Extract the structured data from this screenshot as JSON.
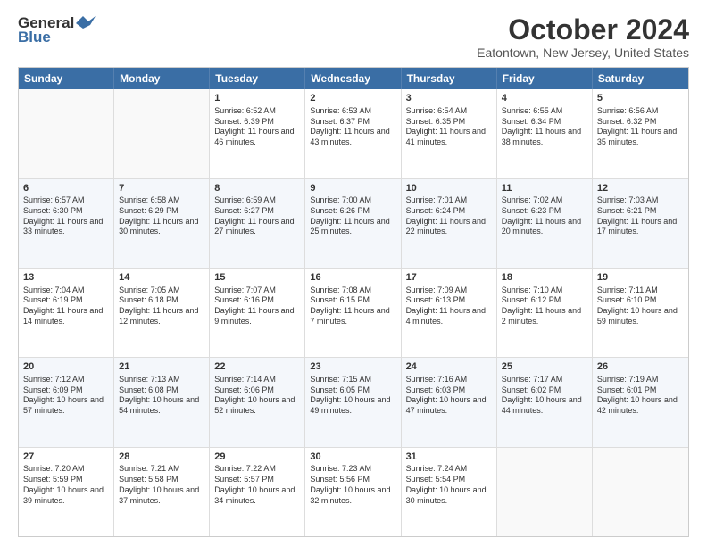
{
  "header": {
    "logo_general": "General",
    "logo_blue": "Blue",
    "month_title": "October 2024",
    "subtitle": "Eatontown, New Jersey, United States"
  },
  "days_of_week": [
    "Sunday",
    "Monday",
    "Tuesday",
    "Wednesday",
    "Thursday",
    "Friday",
    "Saturday"
  ],
  "rows": [
    [
      {
        "day": "",
        "sunrise": "",
        "sunset": "",
        "daylight": "",
        "empty": true
      },
      {
        "day": "",
        "sunrise": "",
        "sunset": "",
        "daylight": "",
        "empty": true
      },
      {
        "day": "1",
        "sunrise": "Sunrise: 6:52 AM",
        "sunset": "Sunset: 6:39 PM",
        "daylight": "Daylight: 11 hours and 46 minutes."
      },
      {
        "day": "2",
        "sunrise": "Sunrise: 6:53 AM",
        "sunset": "Sunset: 6:37 PM",
        "daylight": "Daylight: 11 hours and 43 minutes."
      },
      {
        "day": "3",
        "sunrise": "Sunrise: 6:54 AM",
        "sunset": "Sunset: 6:35 PM",
        "daylight": "Daylight: 11 hours and 41 minutes."
      },
      {
        "day": "4",
        "sunrise": "Sunrise: 6:55 AM",
        "sunset": "Sunset: 6:34 PM",
        "daylight": "Daylight: 11 hours and 38 minutes."
      },
      {
        "day": "5",
        "sunrise": "Sunrise: 6:56 AM",
        "sunset": "Sunset: 6:32 PM",
        "daylight": "Daylight: 11 hours and 35 minutes."
      }
    ],
    [
      {
        "day": "6",
        "sunrise": "Sunrise: 6:57 AM",
        "sunset": "Sunset: 6:30 PM",
        "daylight": "Daylight: 11 hours and 33 minutes."
      },
      {
        "day": "7",
        "sunrise": "Sunrise: 6:58 AM",
        "sunset": "Sunset: 6:29 PM",
        "daylight": "Daylight: 11 hours and 30 minutes."
      },
      {
        "day": "8",
        "sunrise": "Sunrise: 6:59 AM",
        "sunset": "Sunset: 6:27 PM",
        "daylight": "Daylight: 11 hours and 27 minutes."
      },
      {
        "day": "9",
        "sunrise": "Sunrise: 7:00 AM",
        "sunset": "Sunset: 6:26 PM",
        "daylight": "Daylight: 11 hours and 25 minutes."
      },
      {
        "day": "10",
        "sunrise": "Sunrise: 7:01 AM",
        "sunset": "Sunset: 6:24 PM",
        "daylight": "Daylight: 11 hours and 22 minutes."
      },
      {
        "day": "11",
        "sunrise": "Sunrise: 7:02 AM",
        "sunset": "Sunset: 6:23 PM",
        "daylight": "Daylight: 11 hours and 20 minutes."
      },
      {
        "day": "12",
        "sunrise": "Sunrise: 7:03 AM",
        "sunset": "Sunset: 6:21 PM",
        "daylight": "Daylight: 11 hours and 17 minutes."
      }
    ],
    [
      {
        "day": "13",
        "sunrise": "Sunrise: 7:04 AM",
        "sunset": "Sunset: 6:19 PM",
        "daylight": "Daylight: 11 hours and 14 minutes."
      },
      {
        "day": "14",
        "sunrise": "Sunrise: 7:05 AM",
        "sunset": "Sunset: 6:18 PM",
        "daylight": "Daylight: 11 hours and 12 minutes."
      },
      {
        "day": "15",
        "sunrise": "Sunrise: 7:07 AM",
        "sunset": "Sunset: 6:16 PM",
        "daylight": "Daylight: 11 hours and 9 minutes."
      },
      {
        "day": "16",
        "sunrise": "Sunrise: 7:08 AM",
        "sunset": "Sunset: 6:15 PM",
        "daylight": "Daylight: 11 hours and 7 minutes."
      },
      {
        "day": "17",
        "sunrise": "Sunrise: 7:09 AM",
        "sunset": "Sunset: 6:13 PM",
        "daylight": "Daylight: 11 hours and 4 minutes."
      },
      {
        "day": "18",
        "sunrise": "Sunrise: 7:10 AM",
        "sunset": "Sunset: 6:12 PM",
        "daylight": "Daylight: 11 hours and 2 minutes."
      },
      {
        "day": "19",
        "sunrise": "Sunrise: 7:11 AM",
        "sunset": "Sunset: 6:10 PM",
        "daylight": "Daylight: 10 hours and 59 minutes."
      }
    ],
    [
      {
        "day": "20",
        "sunrise": "Sunrise: 7:12 AM",
        "sunset": "Sunset: 6:09 PM",
        "daylight": "Daylight: 10 hours and 57 minutes."
      },
      {
        "day": "21",
        "sunrise": "Sunrise: 7:13 AM",
        "sunset": "Sunset: 6:08 PM",
        "daylight": "Daylight: 10 hours and 54 minutes."
      },
      {
        "day": "22",
        "sunrise": "Sunrise: 7:14 AM",
        "sunset": "Sunset: 6:06 PM",
        "daylight": "Daylight: 10 hours and 52 minutes."
      },
      {
        "day": "23",
        "sunrise": "Sunrise: 7:15 AM",
        "sunset": "Sunset: 6:05 PM",
        "daylight": "Daylight: 10 hours and 49 minutes."
      },
      {
        "day": "24",
        "sunrise": "Sunrise: 7:16 AM",
        "sunset": "Sunset: 6:03 PM",
        "daylight": "Daylight: 10 hours and 47 minutes."
      },
      {
        "day": "25",
        "sunrise": "Sunrise: 7:17 AM",
        "sunset": "Sunset: 6:02 PM",
        "daylight": "Daylight: 10 hours and 44 minutes."
      },
      {
        "day": "26",
        "sunrise": "Sunrise: 7:19 AM",
        "sunset": "Sunset: 6:01 PM",
        "daylight": "Daylight: 10 hours and 42 minutes."
      }
    ],
    [
      {
        "day": "27",
        "sunrise": "Sunrise: 7:20 AM",
        "sunset": "Sunset: 5:59 PM",
        "daylight": "Daylight: 10 hours and 39 minutes."
      },
      {
        "day": "28",
        "sunrise": "Sunrise: 7:21 AM",
        "sunset": "Sunset: 5:58 PM",
        "daylight": "Daylight: 10 hours and 37 minutes."
      },
      {
        "day": "29",
        "sunrise": "Sunrise: 7:22 AM",
        "sunset": "Sunset: 5:57 PM",
        "daylight": "Daylight: 10 hours and 34 minutes."
      },
      {
        "day": "30",
        "sunrise": "Sunrise: 7:23 AM",
        "sunset": "Sunset: 5:56 PM",
        "daylight": "Daylight: 10 hours and 32 minutes."
      },
      {
        "day": "31",
        "sunrise": "Sunrise: 7:24 AM",
        "sunset": "Sunset: 5:54 PM",
        "daylight": "Daylight: 10 hours and 30 minutes."
      },
      {
        "day": "",
        "sunrise": "",
        "sunset": "",
        "daylight": "",
        "empty": true
      },
      {
        "day": "",
        "sunrise": "",
        "sunset": "",
        "daylight": "",
        "empty": true
      }
    ]
  ]
}
